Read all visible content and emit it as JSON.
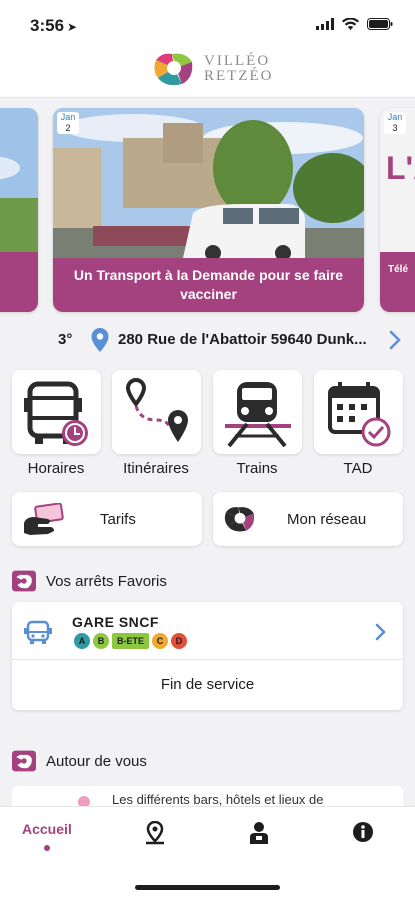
{
  "status": {
    "time": "3:56"
  },
  "brand": {
    "line1": "VILLÉO",
    "line2": "RETZÉO"
  },
  "carousel": {
    "main": {
      "month": "Jan",
      "day": "2",
      "caption": "Un Transport à la Demande pour se faire vacciner"
    },
    "right": {
      "month": "Jan",
      "day": "3",
      "big": "L'A",
      "partial": "Télé"
    }
  },
  "info": {
    "temperature": "3°",
    "address": "280 Rue de l'Abattoir 59640 Dunk..."
  },
  "shortcuts": {
    "horaires": "Horaires",
    "itineraires": "Itinéraires",
    "trains": "Trains",
    "tad": "TAD"
  },
  "wide": {
    "tarifs": "Tarifs",
    "reseau": "Mon réseau"
  },
  "favorites": {
    "title": "Vos arrêts Favoris",
    "stop": "GARE SNCF",
    "lines": [
      {
        "label": "A",
        "color": "#2f9aa0"
      },
      {
        "label": "B",
        "color": "#8dc63f"
      },
      {
        "label": "B-ETE",
        "color": "#8dc63f"
      },
      {
        "label": "C",
        "color": "#f0a830"
      },
      {
        "label": "D",
        "color": "#e0503a"
      }
    ],
    "status": "Fin de service"
  },
  "around": {
    "title": "Autour de vous",
    "text": "Les différents bars, hôtels et lieux de"
  },
  "tabs": {
    "home": "Accueil"
  },
  "colors": {
    "accent": "#a4417f",
    "link": "#2e7fd0"
  }
}
